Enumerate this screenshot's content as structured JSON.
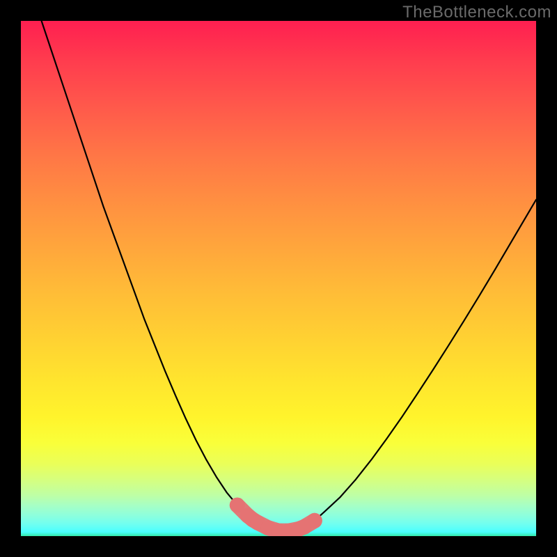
{
  "attribution": "TheBottleneck.com",
  "colors": {
    "curve": "#000000",
    "marker_fill": "#e57373",
    "marker_stroke": "#c85a5a",
    "frame_bg": "#000000"
  },
  "chart_data": {
    "type": "line",
    "title": "",
    "xlabel": "",
    "ylabel": "",
    "xlim": [
      0,
      100
    ],
    "ylim": [
      0,
      100
    ],
    "grid": false,
    "series": [
      {
        "name": "bottleneck-curve",
        "x": [
          4,
          6,
          8,
          10,
          12,
          14,
          16,
          18,
          20,
          22,
          24,
          26,
          28,
          30,
          32,
          34,
          36,
          38,
          40,
          42,
          44,
          45,
          46,
          48,
          50,
          52,
          54,
          55,
          57,
          59,
          62,
          65,
          68,
          71,
          74,
          77,
          80,
          83,
          86,
          89,
          92,
          95,
          98,
          100
        ],
        "y": [
          100,
          94,
          88,
          82,
          76,
          70,
          64,
          58.5,
          53,
          47.5,
          42,
          37,
          32,
          27.3,
          22.8,
          18.6,
          14.8,
          11.4,
          8.4,
          6.0,
          4.0,
          3.2,
          2.6,
          1.6,
          1.0,
          1.0,
          1.4,
          1.8,
          3.0,
          4.8,
          7.6,
          11.0,
          14.8,
          18.9,
          23.2,
          27.7,
          32.3,
          37.0,
          41.8,
          46.7,
          51.7,
          56.8,
          61.9,
          65.3
        ]
      }
    ],
    "markers": {
      "name": "highlight-dots",
      "x": [
        42.0,
        44.0,
        45.0,
        46.0,
        48.0,
        50.0,
        52.0,
        54.0,
        55.0,
        57.0
      ],
      "y": [
        6.0,
        4.0,
        3.2,
        2.6,
        1.6,
        1.0,
        1.0,
        1.4,
        1.8,
        3.0
      ]
    },
    "marker_radius": 11
  }
}
